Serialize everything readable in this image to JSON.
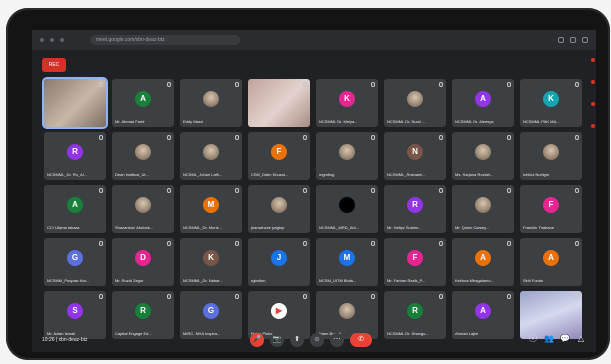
{
  "browser": {
    "address": "meet.google.com/xbn-deaz-btz"
  },
  "recording_badge": "REC",
  "participants": [
    {
      "name": "",
      "kind": "video",
      "selected": true
    },
    {
      "name": "Mr. Ahmad Farid",
      "initial": "A",
      "color": "#188038"
    },
    {
      "name": "Eddy Masri",
      "kind": "avatar"
    },
    {
      "name": "",
      "kind": "video2"
    },
    {
      "name": "NCSMML Dr. Meiya...",
      "initial": "K",
      "color": "#e52592"
    },
    {
      "name": "NCSMML Dr. Nurul ...",
      "kind": "avatar"
    },
    {
      "name": "NCSMML Dr. Aleesya",
      "initial": "A",
      "color": "#9334e6"
    },
    {
      "name": "NCSMML PAK MA...",
      "initial": "K",
      "color": "#12a4af"
    },
    {
      "name": "NCSMML_Dr. Ru_Ai...",
      "initial": "R",
      "color": "#9334e6"
    },
    {
      "name": "Dean Institusi_Ut...",
      "kind": "avatar"
    },
    {
      "name": "NCSML_Johan Latfi...",
      "kind": "avatar"
    },
    {
      "name": "CSM_Datin Khuzai...",
      "initial": "F",
      "color": "#e8710a"
    },
    {
      "name": "mgmtlog",
      "kind": "avatar"
    },
    {
      "name": "NCSMML_Rosnaini...",
      "initial": "N",
      "color": "#795548"
    },
    {
      "name": "Ms. Sarjana Roziah...",
      "kind": "avatar"
    },
    {
      "name": "Ichikul Norligm",
      "kind": "avatar"
    },
    {
      "name": "CCI Utama takaaz",
      "initial": "A",
      "color": "#188038"
    },
    {
      "name": "Shazanbun Abubak...",
      "kind": "avatar"
    },
    {
      "name": "NCSMML_Dr. Munir...",
      "initial": "M",
      "color": "#e8710a"
    },
    {
      "name": "jeanwinzee pagtop",
      "kind": "avatar"
    },
    {
      "name": "NCSMML_MRD_Ahi...",
      "kind": "dark"
    },
    {
      "name": "Mr. Hafiyz Sulaim...",
      "initial": "R",
      "color": "#9334e6"
    },
    {
      "name": "Mr. Quinn Carsey...",
      "kind": "avatar"
    },
    {
      "name": "Franklin Thabane",
      "initial": "F",
      "color": "#e52592"
    },
    {
      "name": "NCSMM_Puspaw Nur...",
      "initial": "G",
      "color": "#5b6fdf"
    },
    {
      "name": "Mr. Ruzid Zegor",
      "initial": "D",
      "color": "#e52592"
    },
    {
      "name": "NCSMML_Dr. Nabar...",
      "initial": "K",
      "color": "#795548"
    },
    {
      "name": "rgtmlbm",
      "initial": "J",
      "color": "#1a73e8"
    },
    {
      "name": "NCSM_UITM Bhds...",
      "initial": "M",
      "color": "#1a73e8"
    },
    {
      "name": "Mr. Farhan Razik_P...",
      "initial": "F",
      "color": "#e52592"
    },
    {
      "name": "Kekhua Mhagalamo...",
      "initial": "A",
      "color": "#e8710a"
    },
    {
      "name": "Siriti Fonds",
      "initial": "A",
      "color": "#e8710a"
    },
    {
      "name": "Mr. Azlan Ismail",
      "initial": "S",
      "color": "#9334e6"
    },
    {
      "name": "Capital Engage Ed...",
      "initial": "R",
      "color": "#188038"
    },
    {
      "name": "MIRC- NHA Inspira...",
      "initial": "G",
      "color": "#5b6fdf"
    },
    {
      "name": "Patric Pinko",
      "kind": "yt"
    },
    {
      "name": "Naim Brandi",
      "kind": "avatar"
    },
    {
      "name": "NCSMML Dr. Shangu...",
      "initial": "R",
      "color": "#188038"
    },
    {
      "name": "Ahmad Lajim",
      "initial": "A",
      "color": "#9334e6"
    },
    {
      "name": "",
      "kind": "video3"
    }
  ],
  "bottom": {
    "meeting_info": "10:26  |  xbn-deaz-btz",
    "controls": [
      "🎤",
      "📷",
      "⬆",
      "☺",
      "⋯"
    ],
    "end_call": "✆",
    "right_icons": [
      "ⓘ",
      "👥",
      "💬",
      "△"
    ]
  }
}
